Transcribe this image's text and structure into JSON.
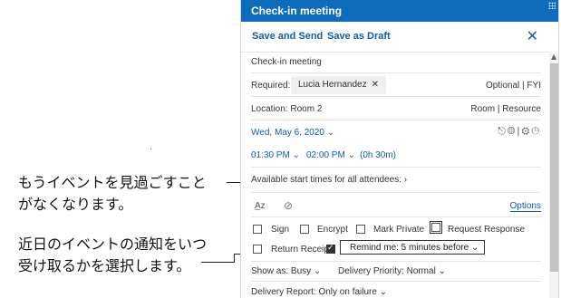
{
  "callouts": {
    "first_line1": "もうイベントを見過ごすこと",
    "first_line2": "がなくなります。",
    "second_line1": "近日のイベントの通知をいつ",
    "second_line2": "受け取るかを選択します。"
  },
  "window": {
    "title": "Check-in meeting"
  },
  "toolbar": {
    "save_send": "Save and Send",
    "save_draft": "Save as Draft",
    "close": "✕"
  },
  "form": {
    "subject": "Check-in meeting",
    "required_label": "Required:",
    "attendee": "Lucia Hernandez",
    "attendee_remove": "✕",
    "optional_fyi": "Optional | FYI",
    "location": "Location:  Room 2",
    "room_resource": "Room | Resource",
    "date": "Wed, May 6, 2020  ⌄",
    "date_icons": "⎋◍|⚙◷",
    "start_time": "01:30 PM  ⌄",
    "end_time": "02:00 PM  ⌄",
    "duration": "(0h 30m)",
    "available": "Available start times for all attendees:  ›"
  },
  "options_bar": {
    "font_icon": "A̲z",
    "attach_icon": "⊘",
    "options": "Options"
  },
  "checkboxes": {
    "sign": {
      "label": "Sign",
      "checked": false
    },
    "encrypt": {
      "label": "Encrypt",
      "checked": false
    },
    "mark_private": {
      "label": "Mark Private",
      "checked": false
    },
    "request_response": {
      "label": "Request Response",
      "checked": false
    },
    "return_receipt": {
      "label": "Return Receipt",
      "checked": false
    },
    "remind": {
      "label": "Remind me:  5 minutes before   ⌄",
      "checked": true
    }
  },
  "details": {
    "show_as": "Show as:  Busy  ⌄",
    "delivery_priority": "Delivery Priority:  Normal  ⌄",
    "delivery_report": "Delivery Report:  Only on failure  ⌄"
  },
  "colors": {
    "accent": "#0f6cbd",
    "link": "#0f5fa8"
  }
}
